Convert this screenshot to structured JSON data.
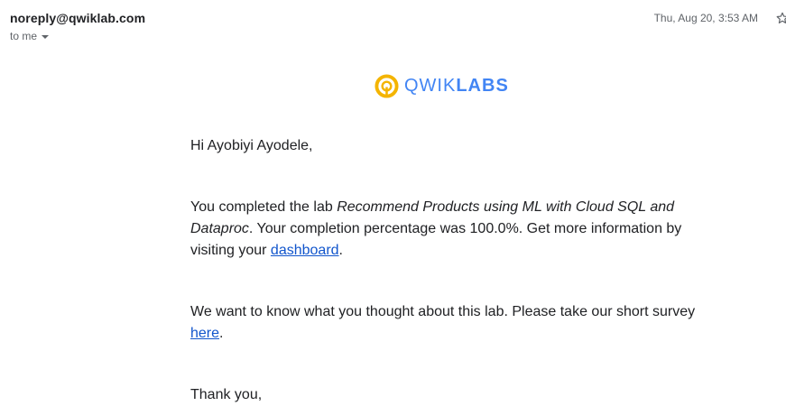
{
  "header": {
    "sender": "noreply@qwiklab.com",
    "recipient": "to me",
    "timestamp": "Thu, Aug 20, 3:53 AM",
    "star_icon": "star-outline-icon"
  },
  "logo": {
    "light_text": "QWIK",
    "bold_text": "LABS",
    "mark_color": "#f4b400",
    "text_color": "#4285f4"
  },
  "message": {
    "greeting": "Hi Ayobiyi Ayodele,",
    "p1_prefix": "You completed the lab ",
    "p1_lab_name": "Recommend Products using ML with Cloud SQL and Dataproc",
    "p1_middle": ". Your completion percentage was 100.0%. Get more information by visiting your ",
    "p1_link": "dashboard",
    "p1_suffix": ".",
    "p2_prefix": "We want to know what you thought about this lab. Please take our short survey ",
    "p2_link": "here",
    "p2_suffix": ".",
    "closing": "Thank you,"
  },
  "colors": {
    "link": "#1155cc",
    "meta_text": "#5f6368"
  }
}
